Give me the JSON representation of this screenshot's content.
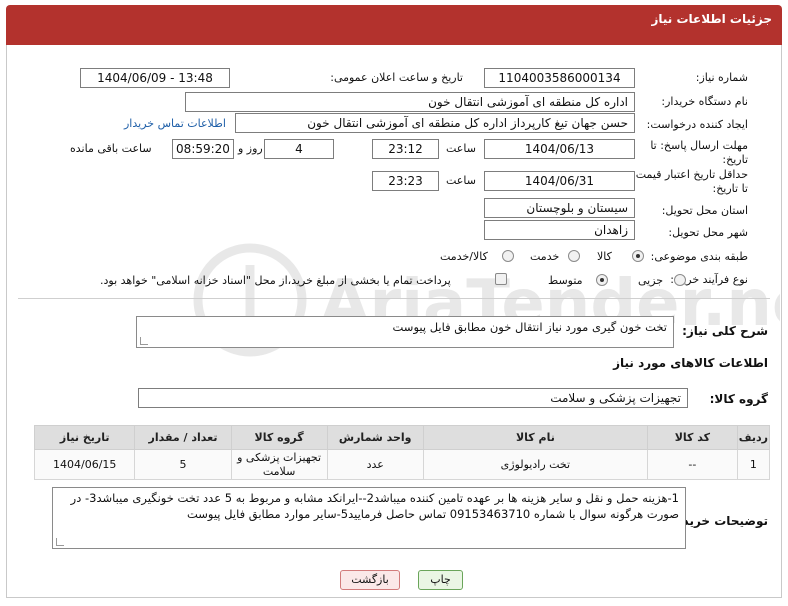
{
  "header": {
    "title": "جزئیات اطلاعات نیاز"
  },
  "form": {
    "need_number_label": "شماره نیاز:",
    "need_number": "1104003586000134",
    "announce_label": "تاریخ و ساعت اعلان عمومی:",
    "announce_value": "1404/06/09 - 13:48",
    "buyer_org_label": "نام دستگاه خریدار:",
    "buyer_org": "اداره کل منطقه ای آموزشی انتقال خون",
    "requester_label": "ایجاد کننده درخواست:",
    "requester": "حسن جهان تیغ کارپرداز اداره کل منطقه ای آموزشی انتقال خون",
    "contact_link": "اطلاعات تماس خریدار",
    "deadline_label_1": "مهلت ارسال پاسخ: تا",
    "deadline_label_2": "تاریخ:",
    "deadline_date": "1404/06/13",
    "time_label": "ساعت",
    "deadline_time": "23:12",
    "days_value": "4",
    "days_label": "روز و",
    "remaining_time": "08:59:20",
    "remaining_label": "ساعت باقی مانده",
    "price_label_1": "حداقل تاریخ اعتبار قیمت:",
    "price_label_2": "تا تاریخ:",
    "price_date": "1404/06/31",
    "price_time": "23:23",
    "province_label": "استان محل تحویل:",
    "province": "سیستان و بلوچستان",
    "city_label": "شهر محل تحویل:",
    "city": "زاهدان",
    "category_label": "طبقه بندی موضوعی:",
    "category_options": [
      "کالا",
      "خدمت",
      "کالا/خدمت"
    ],
    "process_label": "نوع فرآیند خرید :",
    "process_options": [
      "جزیی",
      "متوسط"
    ],
    "payment_note": "پرداخت تمام یا بخشی از مبلغ خرید،از محل \"اسناد خزانه اسلامی\" خواهد بود."
  },
  "description": {
    "label": "شرح کلی نیاز:",
    "value": "تخت خون گیری مورد نیاز انتقال خون مطابق فایل پیوست"
  },
  "goods": {
    "section_title": "اطلاعات کالاهای مورد نیاز",
    "group_label": "گروه کالا:",
    "group_value": "تجهیزات پزشکی و سلامت",
    "columns": [
      "ردیف",
      "کد کالا",
      "نام کالا",
      "واحد شمارش",
      "گروه کالا",
      "تعداد / مقدار",
      "تاریخ نیاز"
    ],
    "rows": [
      [
        "1",
        "--",
        "تخت رادیولوژی",
        "عدد",
        "تجهیزات پزشکی و سلامت",
        "5",
        "1404/06/15"
      ]
    ]
  },
  "buyer_notes": {
    "label": "توضیحات خریدار:",
    "value": "1-هزینه حمل و نقل و سایر هزینه ها  بر عهده تامین کننده میباشد2--ایرانکد مشابه و مربوط به 5 عدد تخت خونگیری میباشد3- در صورت هرگونه سوال با شماره 09153463710 تماس حاصل فرمایید5-سایر موارد مطابق فایل پیوست"
  },
  "buttons": {
    "print": "چاپ",
    "back": "بازگشت"
  },
  "watermark": {
    "text": "AriaTender.neT"
  },
  "colors": {
    "header": "#b3322d",
    "link": "#1f5fa8"
  }
}
